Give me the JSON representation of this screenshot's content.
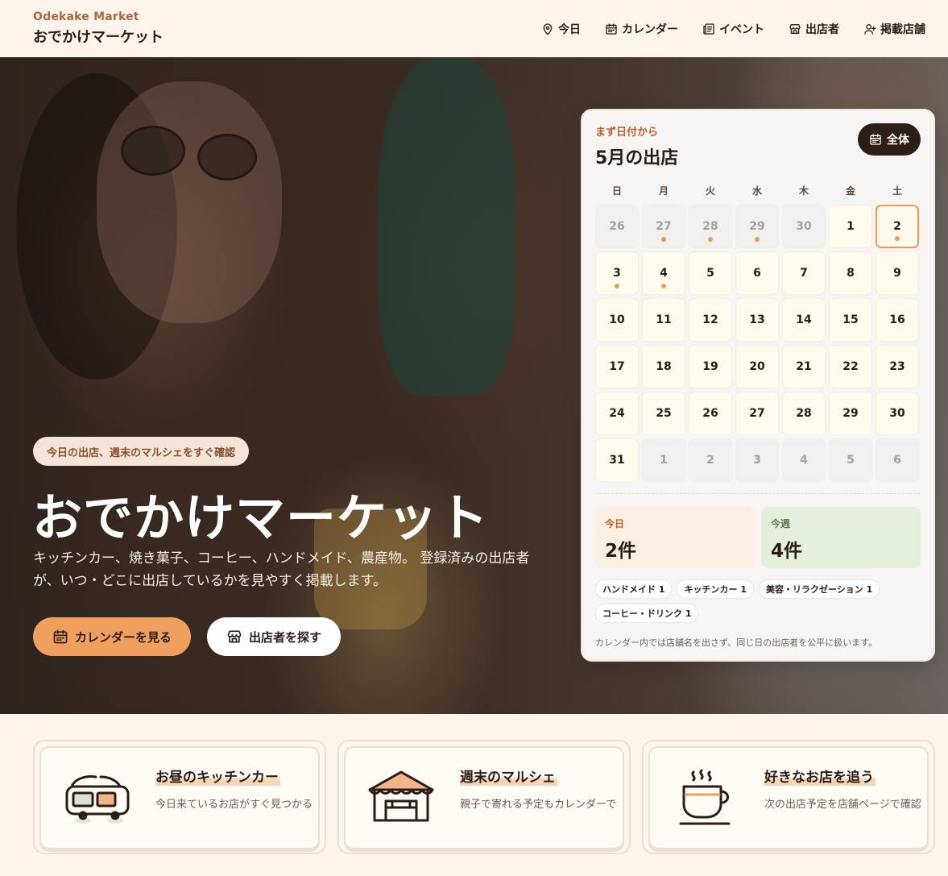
{
  "header": {
    "brand_en": "Odekake Market",
    "brand_ja": "おでかけマーケット",
    "nav": [
      {
        "label": "今日",
        "icon": "map-pin-icon"
      },
      {
        "label": "カレンダー",
        "icon": "calendar-icon"
      },
      {
        "label": "イベント",
        "icon": "newspaper-icon"
      },
      {
        "label": "出店者",
        "icon": "store-icon"
      },
      {
        "label": "掲載店舗",
        "icon": "user-plus-icon"
      }
    ]
  },
  "hero": {
    "pill": "今日の出店、週末のマルシェをすぐ確認",
    "title": "おでかけマーケット",
    "description": "キッチンカー、焼き菓子、コーヒー、ハンドメイド、農産物。 登録済みの出店者が、いつ・どこに出店しているかを見やすく掲載します。",
    "primary_button": "カレンダーを見る",
    "secondary_button": "出店者を探す"
  },
  "calendar": {
    "kicker": "まず日付から",
    "title": "5月の出店",
    "all_button": "全体",
    "weekdays": [
      "日",
      "月",
      "火",
      "水",
      "木",
      "金",
      "土"
    ],
    "days": [
      {
        "n": "26",
        "muted": true,
        "dot": false
      },
      {
        "n": "27",
        "muted": true,
        "dot": true
      },
      {
        "n": "28",
        "muted": true,
        "dot": true
      },
      {
        "n": "29",
        "muted": true,
        "dot": true
      },
      {
        "n": "30",
        "muted": true,
        "dot": false
      },
      {
        "n": "1",
        "muted": false,
        "dot": false
      },
      {
        "n": "2",
        "muted": false,
        "dot": true,
        "today": true
      },
      {
        "n": "3",
        "muted": false,
        "dot": true
      },
      {
        "n": "4",
        "muted": false,
        "dot": true
      },
      {
        "n": "5",
        "muted": false,
        "dot": false
      },
      {
        "n": "6",
        "muted": false,
        "dot": false
      },
      {
        "n": "7",
        "muted": false,
        "dot": false
      },
      {
        "n": "8",
        "muted": false,
        "dot": false
      },
      {
        "n": "9",
        "muted": false,
        "dot": false
      },
      {
        "n": "10",
        "muted": false,
        "dot": false
      },
      {
        "n": "11",
        "muted": false,
        "dot": false
      },
      {
        "n": "12",
        "muted": false,
        "dot": false
      },
      {
        "n": "13",
        "muted": false,
        "dot": false
      },
      {
        "n": "14",
        "muted": false,
        "dot": false
      },
      {
        "n": "15",
        "muted": false,
        "dot": false
      },
      {
        "n": "16",
        "muted": false,
        "dot": false
      },
      {
        "n": "17",
        "muted": false,
        "dot": false
      },
      {
        "n": "18",
        "muted": false,
        "dot": false
      },
      {
        "n": "19",
        "muted": false,
        "dot": false
      },
      {
        "n": "20",
        "muted": false,
        "dot": false
      },
      {
        "n": "21",
        "muted": false,
        "dot": false
      },
      {
        "n": "22",
        "muted": false,
        "dot": false
      },
      {
        "n": "23",
        "muted": false,
        "dot": false
      },
      {
        "n": "24",
        "muted": false,
        "dot": false
      },
      {
        "n": "25",
        "muted": false,
        "dot": false
      },
      {
        "n": "26",
        "muted": false,
        "dot": false
      },
      {
        "n": "27",
        "muted": false,
        "dot": false
      },
      {
        "n": "28",
        "muted": false,
        "dot": false
      },
      {
        "n": "29",
        "muted": false,
        "dot": false
      },
      {
        "n": "30",
        "muted": false,
        "dot": false
      },
      {
        "n": "31",
        "muted": false,
        "dot": false
      },
      {
        "n": "1",
        "muted": true,
        "dot": false
      },
      {
        "n": "2",
        "muted": true,
        "dot": false
      },
      {
        "n": "3",
        "muted": true,
        "dot": false
      },
      {
        "n": "4",
        "muted": true,
        "dot": false
      },
      {
        "n": "5",
        "muted": true,
        "dot": false
      },
      {
        "n": "6",
        "muted": true,
        "dot": false
      }
    ],
    "stats": {
      "today_label": "今日",
      "today_value": "2件",
      "week_label": "今週",
      "week_value": "4件"
    },
    "tags": [
      "ハンドメイド 1",
      "キッチンカー 1",
      "美容・リラクゼーション 1",
      "コーヒー・ドリンク 1"
    ],
    "note": "カレンダー内では店舗名を出さず、同じ日の出店者を公平に扱います。"
  },
  "features": [
    {
      "title": "お昼のキッチンカー",
      "desc": "今日来ているお店がすぐ見つかる",
      "icon": "food-truck-icon"
    },
    {
      "title": "週末のマルシェ",
      "desc": "親子で寄れる予定もカレンダーで",
      "icon": "market-stall-icon"
    },
    {
      "title": "好きなお店を追う",
      "desc": "次の出店予定を店舗ページで確認",
      "icon": "coffee-cup-icon"
    }
  ],
  "colors": {
    "accent": "#f0a05e",
    "brand": "#b0673a",
    "dark": "#2d1f18",
    "event_dot": "#ee9a55",
    "week_bg": "#e5f0dc"
  }
}
